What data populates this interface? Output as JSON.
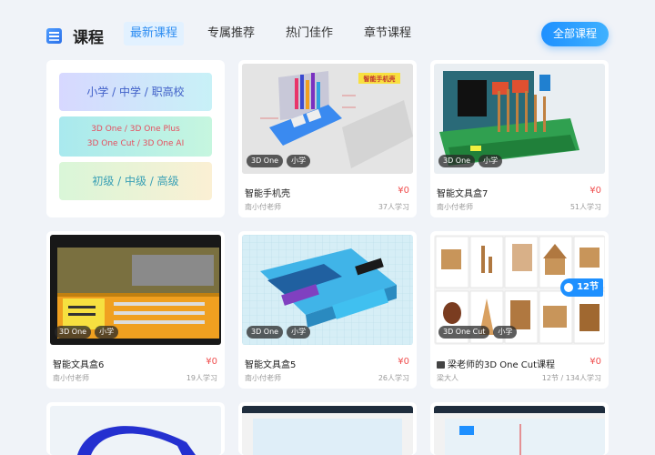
{
  "header": {
    "title": "课程",
    "tabs": [
      "最新课程",
      "专属推荐",
      "热门佳作",
      "章节课程"
    ],
    "all_button": "全部课程"
  },
  "filters": {
    "grades": "小学 / 中学 / 职高校",
    "versions_line1": "3D One / 3D One Plus",
    "versions_line2": "3D One Cut / 3D One AI",
    "levels": "初级 / 中级 / 高级"
  },
  "cards": [
    {
      "title": "智能手机壳",
      "price": "¥0",
      "teacher": "南小付老师",
      "learners": "37人学习",
      "tags": [
        "3D One",
        "小学"
      ],
      "thumb_text": "智能手机壳"
    },
    {
      "title": "智能文具盒7",
      "price": "¥0",
      "teacher": "南小付老师",
      "learners": "51人学习",
      "tags": [
        "3D One",
        "小学"
      ]
    },
    {
      "title": "智能文具盒6",
      "price": "¥0",
      "teacher": "南小付老师",
      "learners": "19人学习",
      "tags": [
        "3D One",
        "小学"
      ]
    },
    {
      "title": "智能文具盒5",
      "price": "¥0",
      "teacher": "南小付老师",
      "learners": "26人学习",
      "tags": [
        "3D One",
        "小学"
      ]
    },
    {
      "title": "梁老师的3D One Cut课程",
      "price": "¥0",
      "teacher": "梁大人",
      "learners": "12节 / 134人学习",
      "tags": [
        "3D One Cut",
        "小学"
      ],
      "badge": "12节"
    }
  ],
  "colors": {
    "accent": "#1e90ff",
    "price": "#f05050",
    "background": "#f0f3f8"
  }
}
